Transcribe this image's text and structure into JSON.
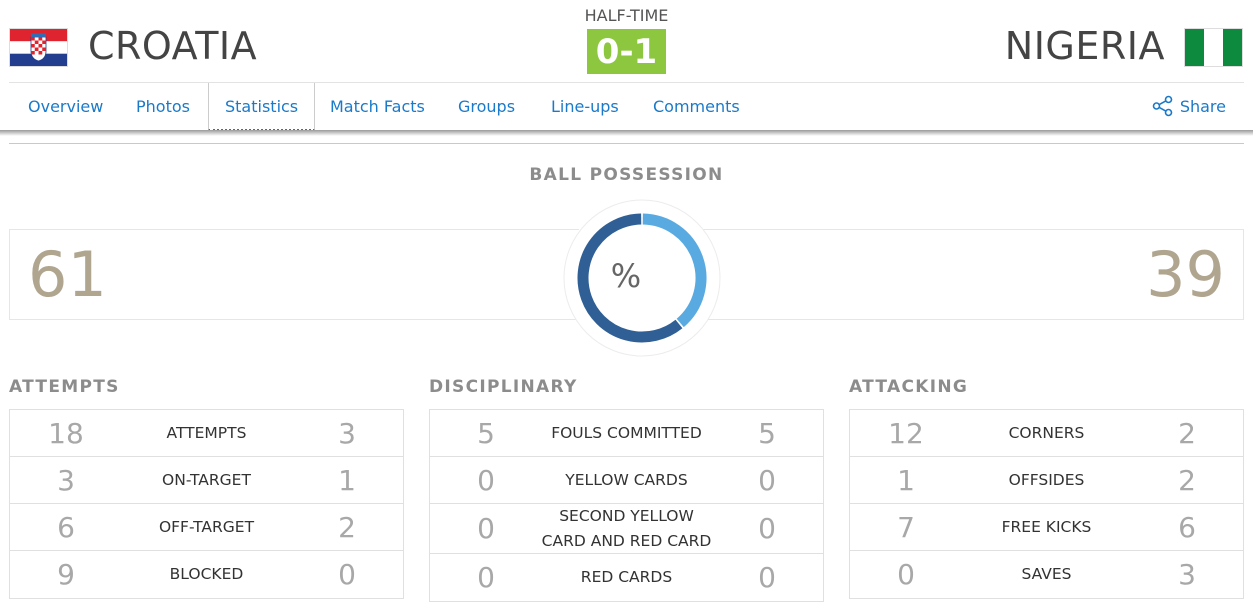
{
  "match": {
    "status": "HALF-TIME",
    "score": "0-1",
    "home": {
      "name": "CROATIA",
      "flag": "croatia-flag"
    },
    "away": {
      "name": "NIGERIA",
      "flag": "nigeria-flag"
    }
  },
  "nav": {
    "items": [
      "Overview",
      "Photos",
      "Statistics",
      "Match Facts",
      "Groups",
      "Line-ups",
      "Comments"
    ],
    "active": "Statistics",
    "share_label": "Share"
  },
  "possession": {
    "title": "BALL POSSESSION",
    "home": 61,
    "away": 39,
    "unit": "%",
    "home_color": "#2f5f95",
    "away_color": "#5aaae2"
  },
  "groups": [
    {
      "title": "ATTEMPTS",
      "rows": [
        {
          "label": "ATTEMPTS",
          "home": "18",
          "away": "3"
        },
        {
          "label": "ON-TARGET",
          "home": "3",
          "away": "1"
        },
        {
          "label": "OFF-TARGET",
          "home": "6",
          "away": "2"
        },
        {
          "label": "BLOCKED",
          "home": "9",
          "away": "0"
        }
      ]
    },
    {
      "title": "DISCIPLINARY",
      "rows": [
        {
          "label": "FOULS COMMITTED",
          "home": "5",
          "away": "5"
        },
        {
          "label": "YELLOW CARDS",
          "home": "0",
          "away": "0"
        },
        {
          "label": "SECOND YELLOW CARD AND RED CARD",
          "home": "0",
          "away": "0"
        },
        {
          "label": "RED CARDS",
          "home": "0",
          "away": "0"
        }
      ]
    },
    {
      "title": "ATTACKING",
      "rows": [
        {
          "label": "CORNERS",
          "home": "12",
          "away": "2"
        },
        {
          "label": "OFFSIDES",
          "home": "1",
          "away": "2"
        },
        {
          "label": "FREE KICKS",
          "home": "7",
          "away": "6"
        },
        {
          "label": "SAVES",
          "home": "0",
          "away": "3"
        }
      ]
    }
  ],
  "colors": {
    "score_bg": "#8dc63f",
    "link": "#1a7ac9",
    "stat_number": "#a8a8a8",
    "possession_number": "#b0a58f"
  }
}
